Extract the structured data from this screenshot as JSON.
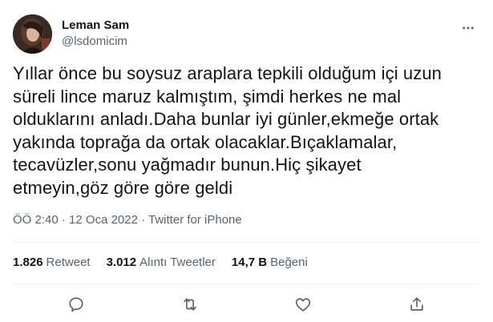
{
  "user": {
    "display_name": "Leman Sam",
    "handle": "@lsdomicim"
  },
  "tweet": {
    "text": "Yıllar önce bu soysuz araplara tepkili olduğum içi uzun\nsüreli lince maruz kalmıştım, şimdi herkes ne mal\nolduklarını anladı.Daha bunlar iyi günler,ekmeğe ortak\nyakında toprağa da ortak olacaklar.Bıçaklamalar,\ntecavüzler,sonu yağmadır bunun.Hiç şikayet\netmeyin,göz göre göre geldi",
    "time": "ÖÖ 2:40",
    "separator": " · ",
    "date": "12 Oca 2022",
    "source": "Twitter for iPhone"
  },
  "stats": {
    "retweets_count": "1.826",
    "retweets_label": "Retweet",
    "quotes_count": "3.012",
    "quotes_label": "Alıntı Tweetler",
    "likes_count": "14,7 B",
    "likes_label": "Beğeni"
  },
  "icons": {
    "more": "more-horizontal-icon",
    "reply": "reply-icon",
    "retweet": "retweet-icon",
    "like": "like-heart-icon",
    "share": "share-icon"
  },
  "colors": {
    "text_primary": "#0f1419",
    "text_secondary": "#536471",
    "divider": "#eff3f4"
  }
}
